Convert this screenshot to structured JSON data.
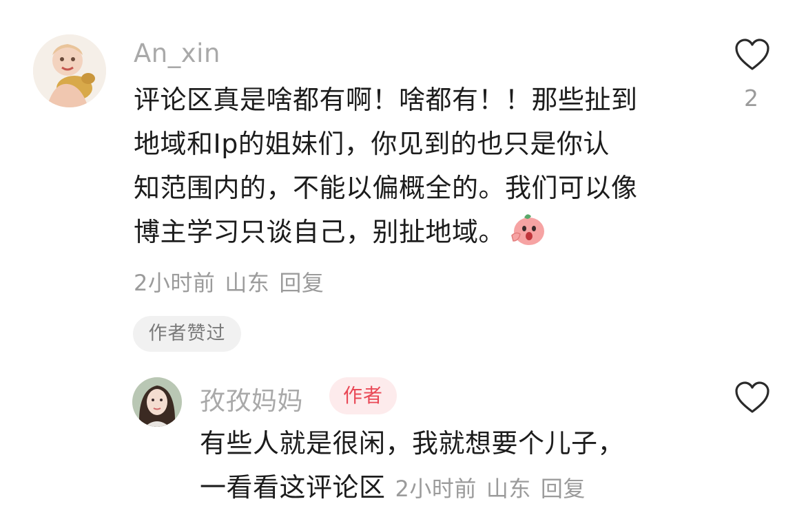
{
  "comment1": {
    "username": "An_xin",
    "lines": [
      "评论区真是啥都有啊！啥都有！！那些扯到",
      "地域和Ip的姐妹们，你见到的也只是你认",
      "知范围内的，不能以偏概全的。我们可以像",
      "博主学习只谈自己，别扯地域。"
    ],
    "emoji": "shouting-peach-emoji",
    "time": "2小时前",
    "location": "山东",
    "reply_label": "回复",
    "like_count": "2",
    "author_liked_label": "作者赞过"
  },
  "comment2": {
    "username": "孜孜妈妈",
    "author_badge": "作者",
    "lines": [
      "有些人就是很闲，我就想要个儿子，",
      "一看看这评论区"
    ],
    "time": "2小时前",
    "location": "山东",
    "reply_label": "回复"
  },
  "colors": {
    "username": "#a9a9a9",
    "text": "#1c1c1c",
    "meta": "#9b9b9b",
    "badge_bg": "#fdebec",
    "badge_text": "#e94856",
    "pill_bg": "#f1f1f1"
  }
}
